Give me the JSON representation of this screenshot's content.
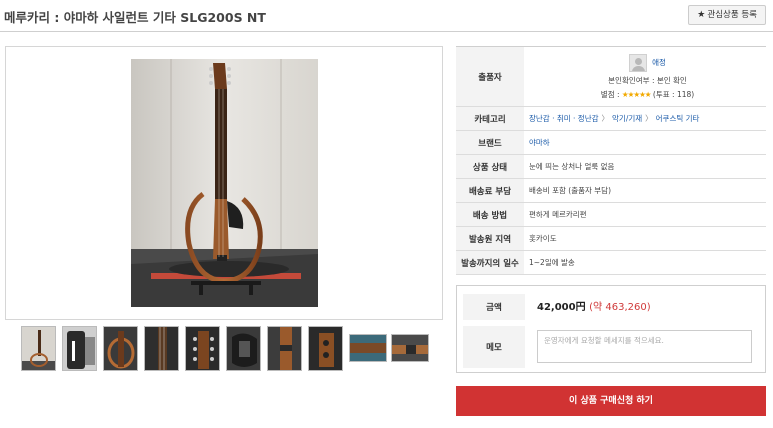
{
  "header": {
    "title": "메루카리 : 야마하 사일런트 기타 SLG200S NT",
    "fav_button": "관심상품 등록",
    "fav_icon": "star-icon"
  },
  "gallery": {
    "thumbnail_count": 10
  },
  "info": {
    "seller_label": "출품자",
    "seller_name": "애정",
    "identity_text": "본인확인여부 : 본인 확인",
    "rating_prefix": "별점 : ",
    "rating_stars": "★★★★★",
    "rating_votes": "(투표 : 118)",
    "category_label": "카테고리",
    "category_1": "장난감 · 취미 · 정난감",
    "category_2": "악기/기재",
    "category_3": "어쿠스틱 기타",
    "category_sep": "〉",
    "brand_label": "브랜드",
    "brand_value": "야마하",
    "condition_label": "상품 상태",
    "condition_value": "눈에 띄는 상처나 얼룩 없음",
    "shipping_fee_label": "배송료 부담",
    "shipping_fee_value": "배송비 포함 (출품자 부담)",
    "shipping_method_label": "배송 방법",
    "shipping_method_value": "편하게 메르카리편",
    "origin_label": "발송원 지역",
    "origin_value": "홋카이도",
    "days_label": "발송까지의 일수",
    "days_value": "1~2일에 발송"
  },
  "order": {
    "price_label": "금액",
    "price": "42,000円",
    "price_converted": "(약 463,260)",
    "memo_label": "메모",
    "memo_placeholder": "운영자에게 요청할 메세지를 적으세요.",
    "buy_button": "이 상품 구매신청 하기"
  }
}
